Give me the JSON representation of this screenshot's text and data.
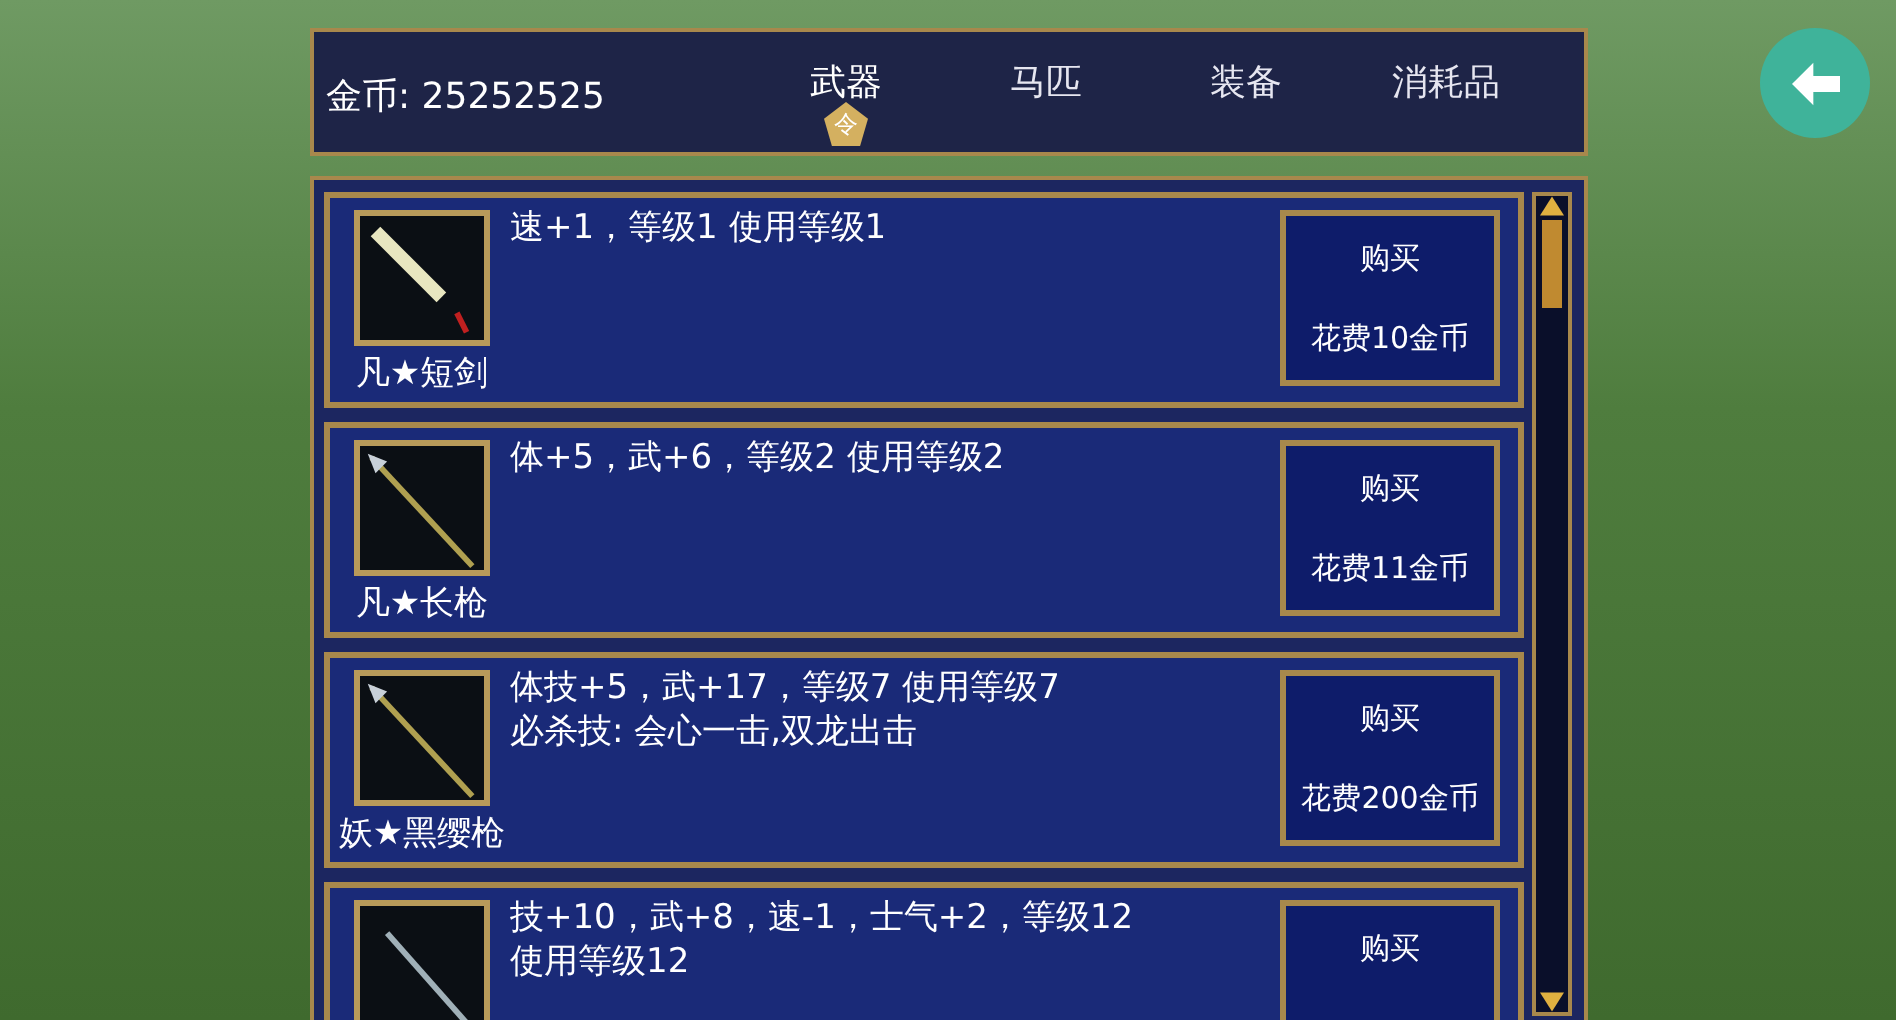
{
  "header": {
    "gold_label": "金币: 25252525",
    "selected_badge": "令",
    "tabs": [
      {
        "label": "武器",
        "selected": true
      },
      {
        "label": "马匹",
        "selected": false
      },
      {
        "label": "装备",
        "selected": false
      },
      {
        "label": "消耗品",
        "selected": false
      }
    ]
  },
  "items": [
    {
      "name": "凡★短剑",
      "stats": [
        "速+1，等级1 使用等级1"
      ],
      "buy": "购买",
      "cost": "花费10金币",
      "kind": "sword"
    },
    {
      "name": "凡★长枪",
      "stats": [
        "体+5，武+6，等级2 使用等级2"
      ],
      "buy": "购买",
      "cost": "花费11金币",
      "kind": "spear"
    },
    {
      "name": "妖★黑缨枪",
      "stats": [
        "体技+5，武+17，等级7 使用等级7",
        "必杀技: 会心一击,双龙出击"
      ],
      "buy": "购买",
      "cost": "花费200金币",
      "kind": "spear"
    },
    {
      "stats": [
        "技+10，武+8，速-1，士气+2，等级12",
        "使用等级12"
      ],
      "buy": "购买",
      "kind": "crescent"
    }
  ]
}
